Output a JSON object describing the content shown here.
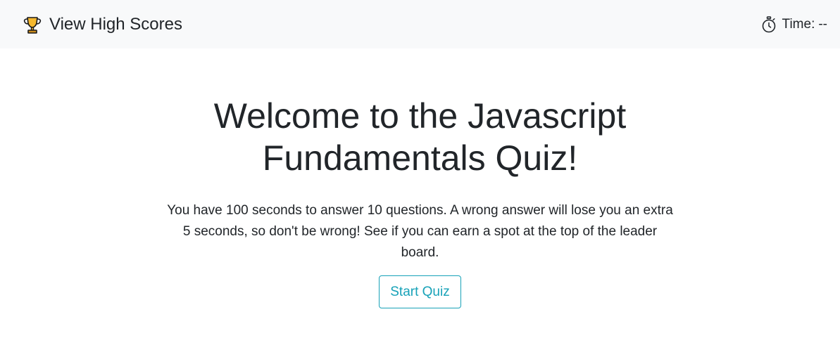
{
  "navbar": {
    "high_scores_label": "View High Scores",
    "high_scores_icon": "trophy-icon",
    "timer_icon": "stopwatch-icon",
    "timer_label": "Time:",
    "timer_value": "--"
  },
  "main": {
    "title": "Welcome to the Javascript Fundamentals Quiz!",
    "description": "You have 100 seconds to answer 10 questions. A wrong answer will lose you an extra 5 seconds, so don't be wrong! See if you can earn a spot at the top of the leader board.",
    "start_button_label": "Start Quiz"
  },
  "colors": {
    "navbar_background": "#f8f9fa",
    "accent": "#17a2b8",
    "text": "#212529"
  }
}
